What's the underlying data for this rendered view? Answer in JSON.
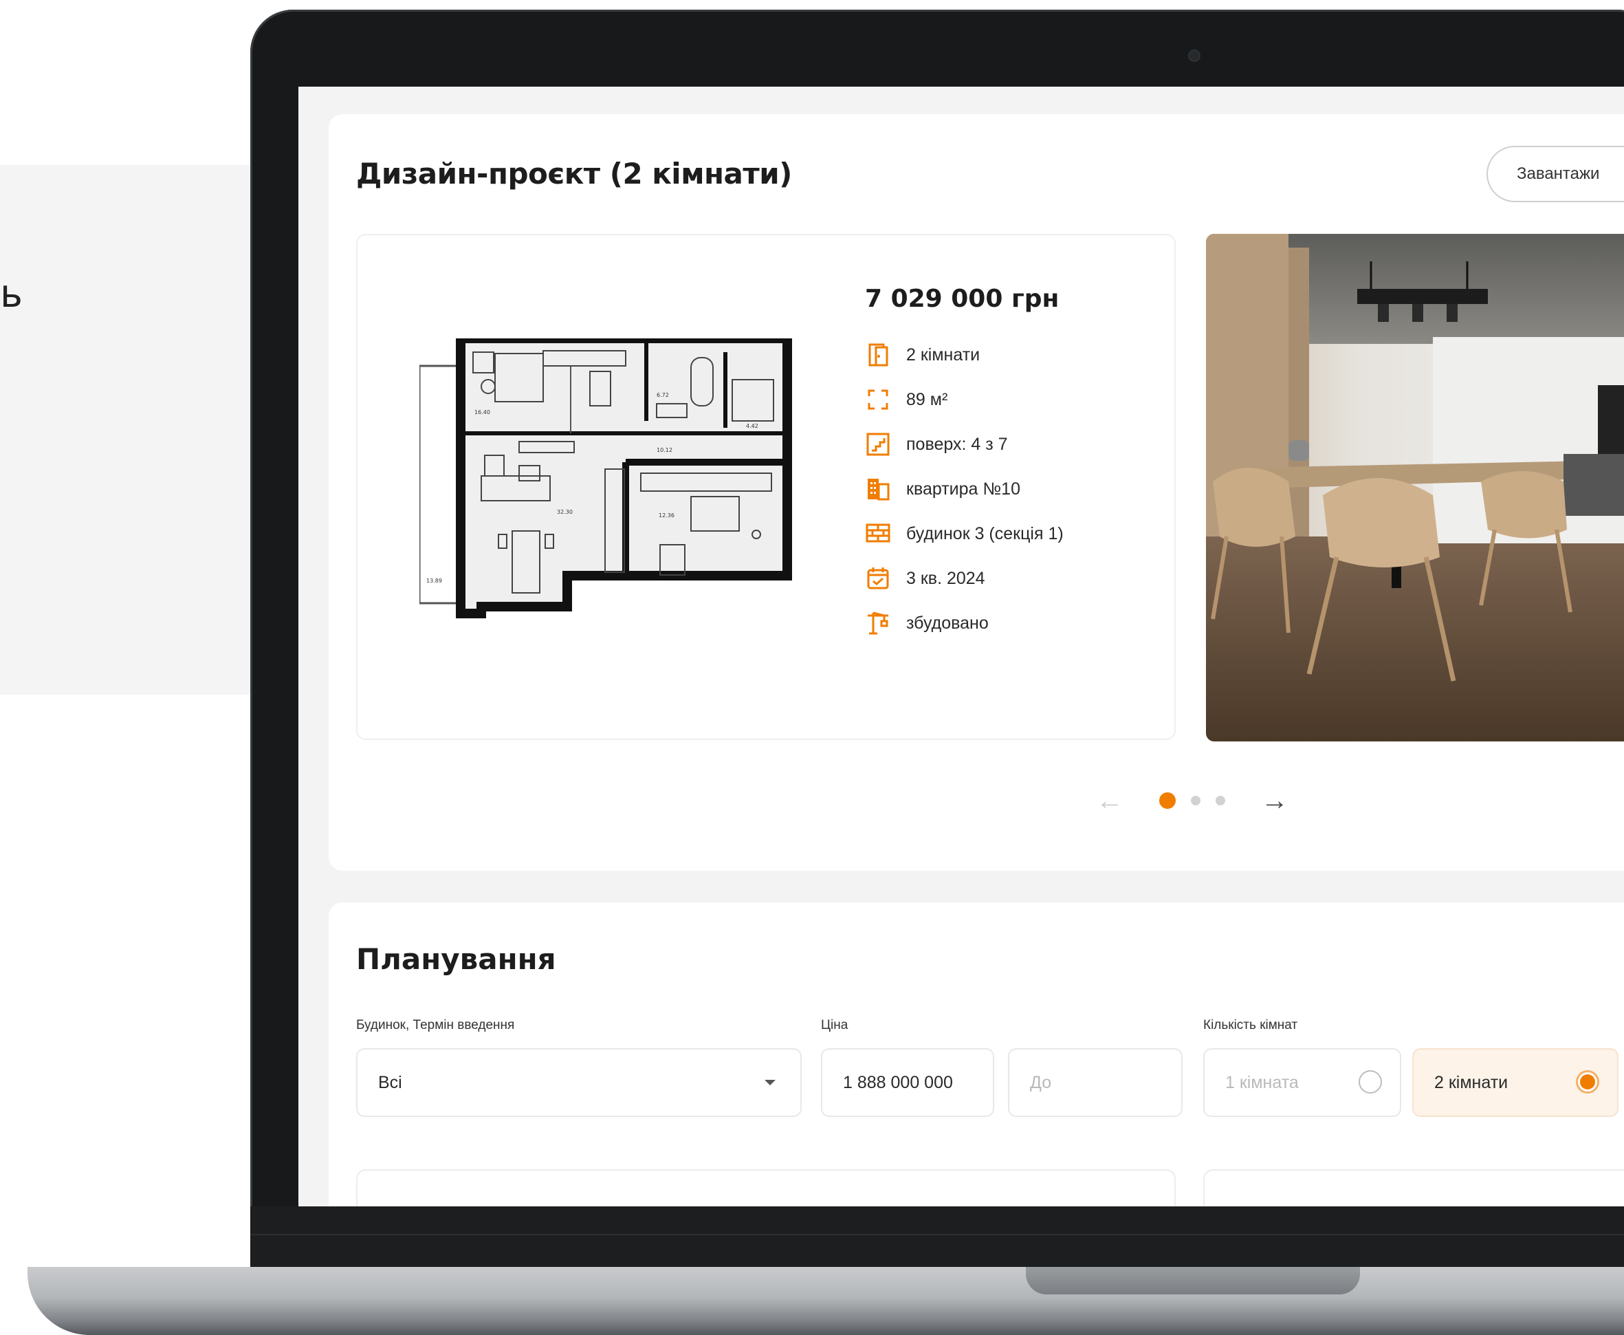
{
  "background": {
    "partial_text": "ь"
  },
  "section_design": {
    "title": "Дизайн-проєкт (2 кімнати)",
    "download_label": "Завантажи",
    "price": "7 029 000 грн",
    "specs": [
      {
        "icon": "door-icon",
        "label": "2 кімнати"
      },
      {
        "icon": "area-icon",
        "label": "89 м²"
      },
      {
        "icon": "stairs-icon",
        "label": "поверх: 4 з 7"
      },
      {
        "icon": "building-icon",
        "label": "квартира №10"
      },
      {
        "icon": "bricks-icon",
        "label": "будинок 3 (секція 1)"
      },
      {
        "icon": "calendar-icon",
        "label": "3 кв. 2024"
      },
      {
        "icon": "crane-icon",
        "label": "збудовано"
      }
    ],
    "floorplan_rooms": [
      "16.40",
      "6.72",
      "4.42",
      "10.12",
      "32.30",
      "12.36",
      "13.89"
    ],
    "pager": {
      "count": 3,
      "active": 1
    }
  },
  "section_planning": {
    "title": "Планування",
    "labels": {
      "building": "Будинок, Термін введення",
      "price": "Ціна",
      "rooms": "Кількість кімнат"
    },
    "building_value": "Всі",
    "price_from": "1 888 000 000",
    "price_to_placeholder": "До",
    "room_options": [
      {
        "label": "1 кімната",
        "selected": false
      },
      {
        "label": "2 кімнати",
        "selected": true
      }
    ]
  },
  "colors": {
    "accent": "#f07d00",
    "text": "#1d1d1d",
    "border": "#e8e8e8"
  }
}
